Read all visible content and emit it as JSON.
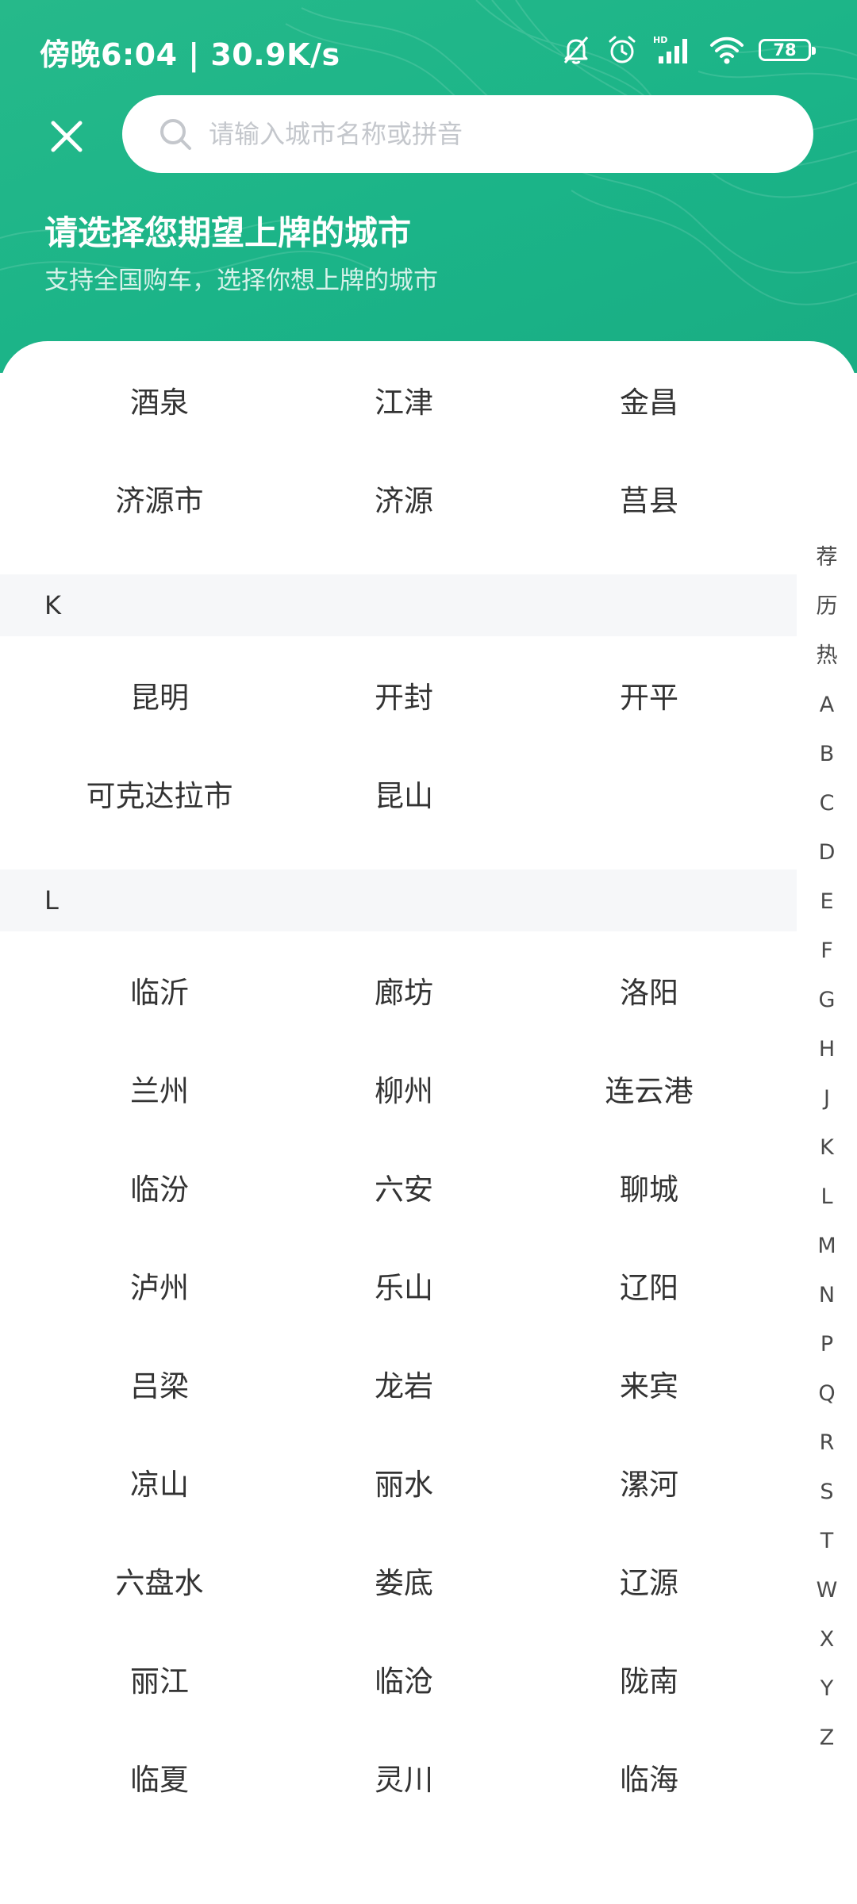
{
  "status_bar": {
    "time": "傍晚6:04 | 30.9K/s",
    "battery": "78",
    "icons": [
      "bell-muted-icon",
      "alarm-icon",
      "hd-signal-icon",
      "wifi-icon",
      "battery-icon"
    ]
  },
  "header": {
    "close_icon": "close-icon",
    "search_placeholder": "请输入城市名称或拼音",
    "title": "请选择您期望上牌的城市",
    "subtitle": "支持全国购车，选择你想上牌的城市",
    "background_color": "#1bb488"
  },
  "city_list": {
    "top_rows": [
      [
        "酒泉",
        "江津",
        "金昌"
      ],
      [
        "济源市",
        "济源",
        "莒县"
      ]
    ],
    "sections": [
      {
        "letter": "K",
        "rows": [
          [
            "昆明",
            "开封",
            "开平"
          ],
          [
            "可克达拉市",
            "昆山"
          ]
        ]
      },
      {
        "letter": "L",
        "rows": [
          [
            "临沂",
            "廊坊",
            "洛阳"
          ],
          [
            "兰州",
            "柳州",
            "连云港"
          ],
          [
            "临汾",
            "六安",
            "聊城"
          ],
          [
            "泸州",
            "乐山",
            "辽阳"
          ],
          [
            "吕梁",
            "龙岩",
            "来宾"
          ],
          [
            "凉山",
            "丽水",
            "漯河"
          ],
          [
            "六盘水",
            "娄底",
            "辽源"
          ],
          [
            "丽江",
            "临沧",
            "陇南"
          ],
          [
            "临夏",
            "灵川",
            "临海"
          ]
        ]
      }
    ]
  },
  "alpha_index": [
    "荐",
    "历",
    "热",
    "A",
    "B",
    "C",
    "D",
    "E",
    "F",
    "G",
    "H",
    "J",
    "K",
    "L",
    "M",
    "N",
    "P",
    "Q",
    "R",
    "S",
    "T",
    "W",
    "X",
    "Y",
    "Z"
  ]
}
